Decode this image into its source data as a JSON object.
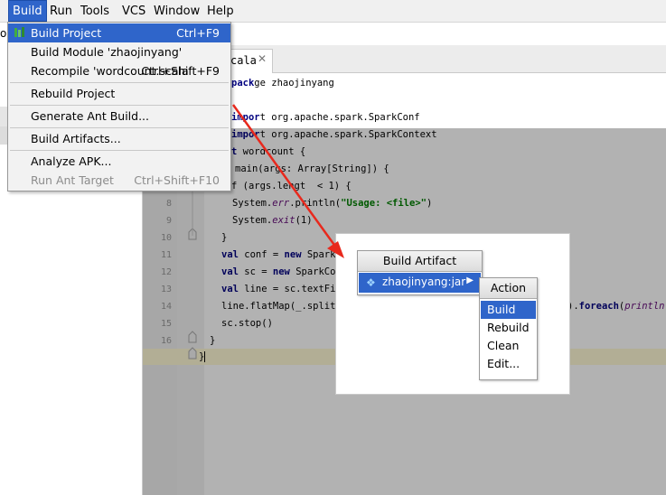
{
  "menubar": {
    "items": [
      {
        "label": "Build",
        "active": true
      },
      {
        "label": "Run"
      },
      {
        "label": "Tools"
      },
      {
        "label": "VCS"
      },
      {
        "label": "Window"
      },
      {
        "label": "Help"
      }
    ]
  },
  "left_panel": {
    "partial_text": "o"
  },
  "editor": {
    "tab_label": "cala",
    "code": {
      "l1": "ge zhaojinyang",
      "l2": "t org.apache.spark.SparkConf",
      "l3": "t org.apache.spark.SparkContext",
      "l4a": "t ",
      "l4b": "wordcount {",
      "l5a": "main(args: Array[String]) {",
      "l6a": "f (args.lengt  < 1) {",
      "l8a": "System.",
      "l8b": "err",
      "l8c": ".println(",
      "l8d": "\"Usage: <file>\"",
      "l8e": ")",
      "l9a": "System.",
      "l9b": "exit",
      "l9c": "(1)",
      "l10": "}",
      "l11a": "val",
      "l11b": " conf = ",
      "l11c": "new",
      "l11d": " Spark",
      "l12a": "val",
      "l12b": " sc = ",
      "l12c": "new",
      "l12d": " SparkCo",
      "l13a": "val",
      "l13b": " line = sc.textFil",
      "l14a": "line.flatMap(_.split(",
      "l14b": ").",
      "l14c": "foreach",
      "l14d": "(",
      "l14e": "println",
      "l14f": ")",
      "l15": "sc.stop()",
      "l16": "}",
      "l17": "}"
    },
    "line_numbers": [
      "8",
      "9",
      "10",
      "11",
      "12",
      "13",
      "14",
      "15",
      "16",
      "17"
    ]
  },
  "build_menu": {
    "items": [
      {
        "label": "Build Project",
        "shortcut": "Ctrl+F9"
      },
      {
        "label": "Build Module 'zhaojinyang'",
        "shortcut": ""
      },
      {
        "label": "Recompile 'wordcount.scala'",
        "shortcut": "Ctrl+Shift+F9"
      },
      {
        "label": "Rebuild Project",
        "shortcut": ""
      },
      {
        "label": "Generate Ant Build...",
        "shortcut": ""
      },
      {
        "label": "Build Artifacts...",
        "shortcut": ""
      },
      {
        "label": "Analyze APK...",
        "shortcut": ""
      },
      {
        "label": "Run Ant Target",
        "shortcut": "Ctrl+Shift+F10"
      }
    ]
  },
  "artifact_popup": {
    "title": "Build Artifact",
    "artifact": "zhaojinyang:jar",
    "action_title": "Action",
    "actions": [
      "Build",
      "Rebuild",
      "Clean",
      "Edit..."
    ]
  },
  "colors": {
    "selection": "#2f65ca",
    "arrow": "#e8291d",
    "keyword": "#000080",
    "string": "#008000"
  }
}
